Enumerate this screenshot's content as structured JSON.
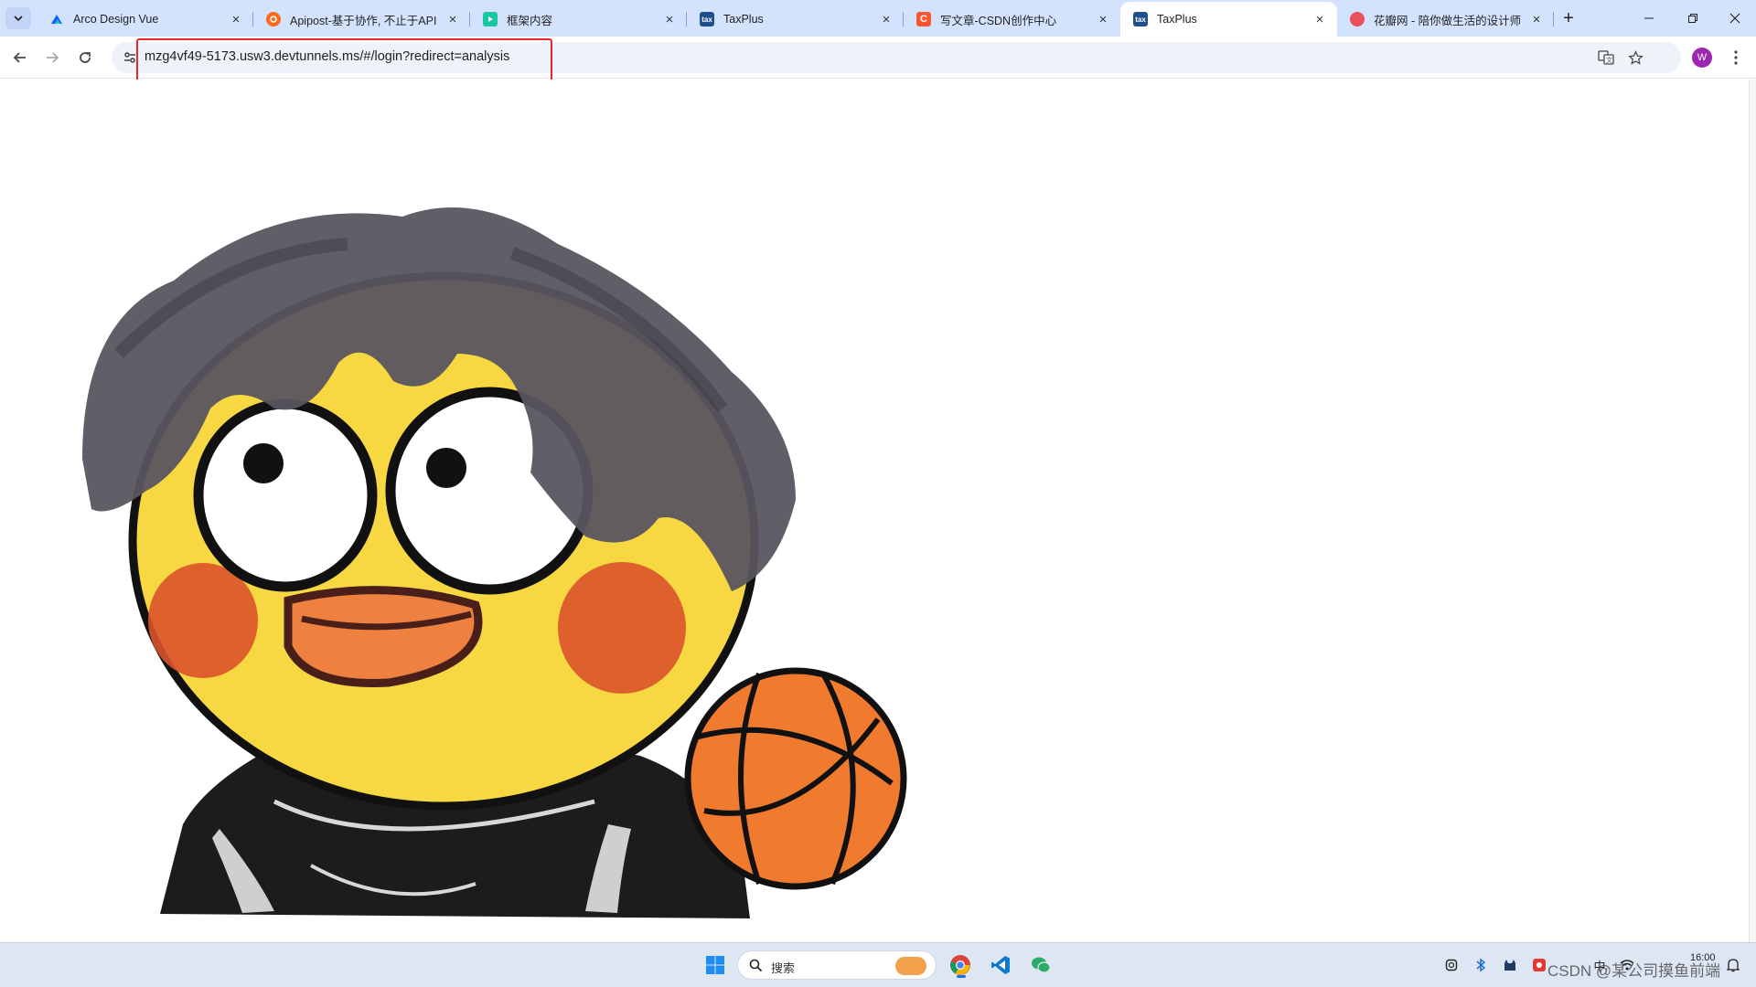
{
  "browser": {
    "tabs": [
      {
        "title": "Arco Design Vue",
        "favicon": "arco-icon",
        "color": "#165dff",
        "active": false
      },
      {
        "title": "Apipost-基于协作, 不止于API",
        "favicon": "apipost-icon",
        "color": "#ff6a1a",
        "active": false
      },
      {
        "title": "框架内容",
        "favicon": "play-icon",
        "color": "#17c8a0",
        "active": false
      },
      {
        "title": "TaxPlus",
        "favicon": "taxplus-icon",
        "color": "#1f4e8c",
        "active": false
      },
      {
        "title": "写文章-CSDN创作中心",
        "favicon": "csdn-icon",
        "color": "#fc5531",
        "active": false
      },
      {
        "title": "TaxPlus",
        "favicon": "taxplus-icon",
        "color": "#1f4e8c",
        "active": true
      },
      {
        "title": "花瓣网 - 陪你做生活的设计师",
        "favicon": "huaban-icon",
        "color": "#e8515a",
        "active": false
      }
    ],
    "favicon_text": "tax",
    "url": "mzg4vf49-5173.usw3.devtunnels.ms/#/login?redirect=analysis",
    "profile_initial": "W",
    "highlight_color": "#e8262b"
  },
  "content": {
    "illustration": "yellow-duck-with-gray-hair-and-basketball"
  },
  "taskbar": {
    "search_label": "搜索",
    "clock_time": "16:00",
    "ime_label": "中",
    "watermark": "CSDN @某公司摸鱼前端"
  }
}
